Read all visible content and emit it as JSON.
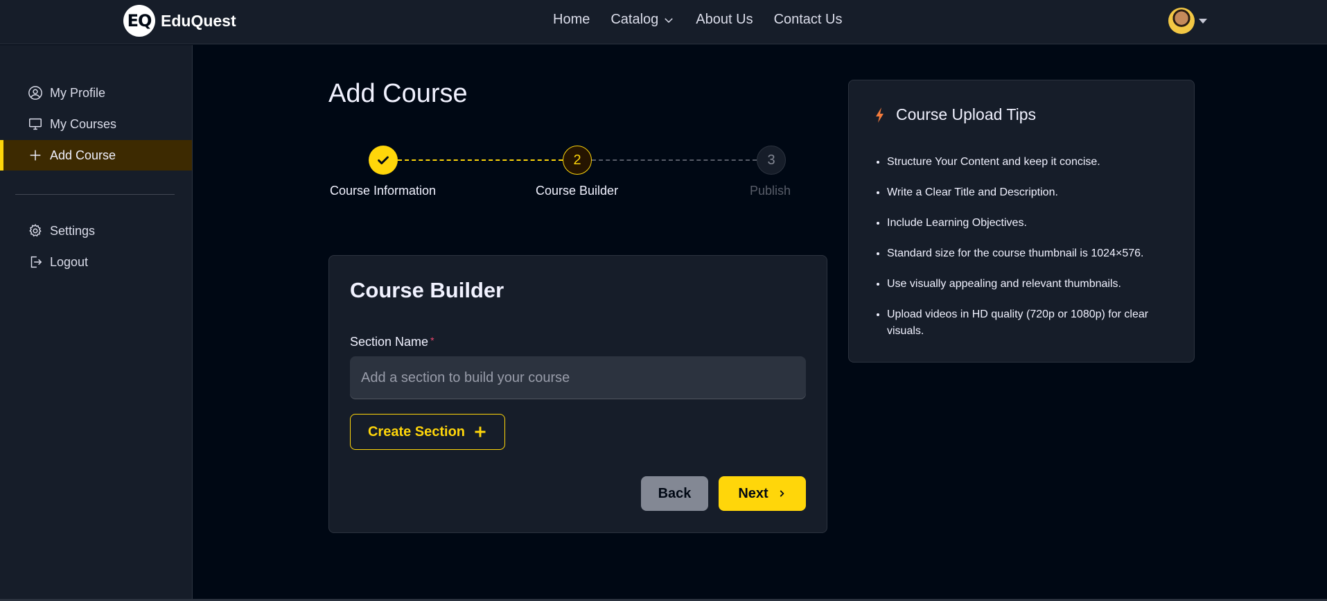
{
  "brand": {
    "logo_text": "EQ",
    "name": "EduQuest"
  },
  "nav": {
    "items": [
      {
        "label": "Home"
      },
      {
        "label": "Catalog",
        "icon": "chevron-down-icon"
      },
      {
        "label": "About Us"
      },
      {
        "label": "Contact Us"
      }
    ]
  },
  "user": {
    "avatar": "avatar",
    "menu_icon": "caret-down-icon"
  },
  "sidebar": {
    "items": [
      {
        "label": "My Profile",
        "icon": "user-circle-icon"
      },
      {
        "label": "My Courses",
        "icon": "monitor-icon"
      },
      {
        "label": "Add Course",
        "icon": "plus-icon",
        "active": true
      },
      {
        "label": "Settings",
        "icon": "gear-icon"
      },
      {
        "label": "Logout",
        "icon": "logout-icon"
      }
    ]
  },
  "page": {
    "title": "Add Course"
  },
  "stepper": {
    "current_step": 2,
    "steps": [
      {
        "number": "1",
        "label": "Course Information",
        "state": "completed"
      },
      {
        "number": "2",
        "label": "Course Builder",
        "state": "active"
      },
      {
        "number": "3",
        "label": "Publish",
        "state": "pending"
      }
    ]
  },
  "builder": {
    "title": "Course Builder",
    "section_name_label": "Section Name",
    "required_mark": "*",
    "section_input_value": "",
    "section_input_placeholder": "Add a section to build your course",
    "create_section_label": "Create Section",
    "back_label": "Back",
    "next_label": "Next"
  },
  "tips": {
    "title": "Course Upload Tips",
    "icon": "lightning-icon",
    "items": [
      "Structure Your Content and keep it concise.",
      "Write a Clear Title and Description.",
      "Include Learning Objectives.",
      "Standard size for the course thumbnail is 1024×576.",
      "Use visually appealing and relevant thumbnails.",
      "Upload videos in HD quality (720p or 1080p) for clear visuals."
    ]
  },
  "colors": {
    "accent": "#ffd60a",
    "background": "#000814",
    "panel": "#161d29",
    "active_sidebar": "#3d2a01",
    "required": "#ef476f",
    "tip_icon": "#f37b3c"
  }
}
